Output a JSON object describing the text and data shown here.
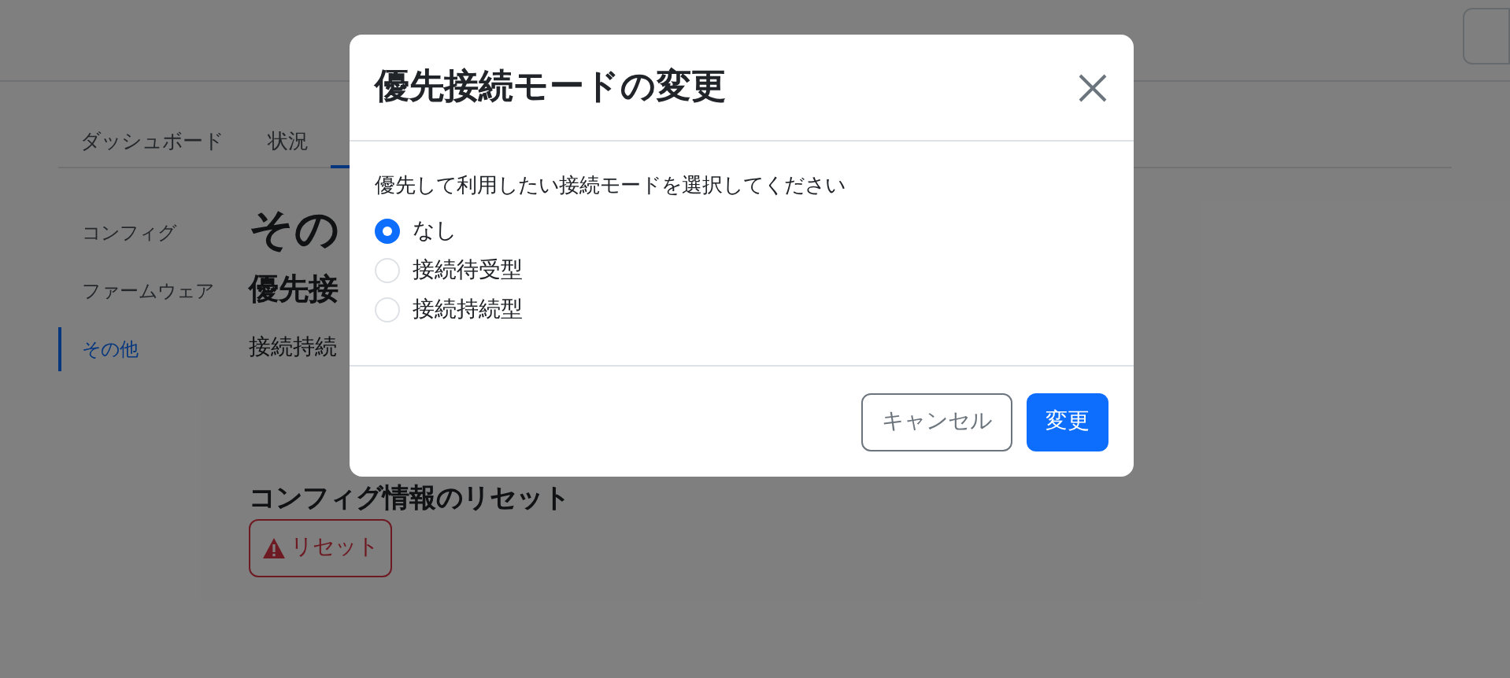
{
  "tabs": [
    {
      "label": "ダッシュボード",
      "selected": false
    },
    {
      "label": "状況",
      "selected": false
    },
    {
      "selected": true
    }
  ],
  "sidebar": {
    "items": [
      {
        "label": "コンフィグ",
        "selected": false
      },
      {
        "label": "ファームウェア",
        "selected": false
      },
      {
        "label": "その他",
        "selected": true
      }
    ]
  },
  "content": {
    "heading": "その",
    "section_title": "優先接",
    "section_text": "接続持続",
    "reset_title": "コンフィグ情報のリセット",
    "reset_button": "リセット"
  },
  "modal": {
    "title": "優先接続モードの変更",
    "prompt": "優先して利用したい接続モードを選択してください",
    "options": [
      {
        "label": "なし",
        "selected": true
      },
      {
        "label": "接続待受型",
        "selected": false
      },
      {
        "label": "接続持続型",
        "selected": false
      }
    ],
    "cancel_button": "キャンセル",
    "confirm_button": "変更"
  }
}
